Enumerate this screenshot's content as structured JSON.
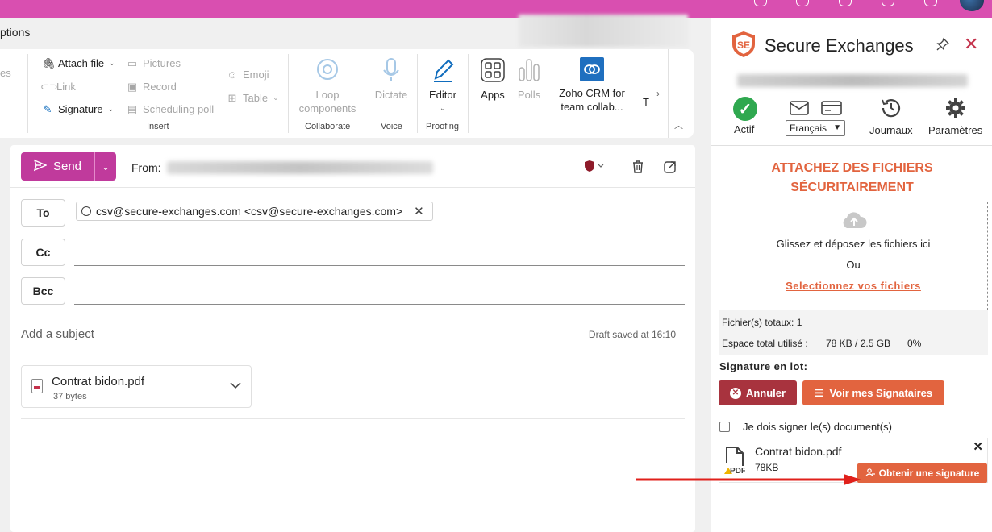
{
  "topbar": {
    "color": "#d94fb0"
  },
  "left_strip": {
    "options_label": "ptions"
  },
  "ribbon": {
    "attach_file": "Attach file",
    "link": "Link",
    "signature": "Signature",
    "pictures": "Pictures",
    "record": "Record",
    "scheduling_poll": "Scheduling poll",
    "emoji": "Emoji",
    "table": "Table",
    "insert_group": "Insert",
    "loop_components": "Loop components",
    "collaborate_group": "Collaborate",
    "dictate": "Dictate",
    "voice_group": "Voice",
    "editor": "Editor",
    "proofing_group": "Proofing",
    "apps": "Apps",
    "polls": "Polls",
    "zoho": "Zoho CRM for team collab...",
    "overflow": "T",
    "truncated_left": "es"
  },
  "compose": {
    "send_label": "Send",
    "from_label": "From:",
    "to_label": "To",
    "cc_label": "Cc",
    "bcc_label": "Bcc",
    "recipient": "csv@secure-exchanges.com <csv@secure-exchanges.com>",
    "subject_placeholder": "Add a subject",
    "draft_status": "Draft saved at 16:10",
    "attachment": {
      "name": "Contrat bidon.pdf",
      "size": "37 bytes"
    }
  },
  "panel": {
    "title": "Secure Exchanges",
    "nav": {
      "actif": "Actif",
      "language": "Français",
      "journaux": "Journaux",
      "parametres": "Paramètres"
    },
    "attach_title_line1": "ATTACHEZ DES FICHIERS",
    "attach_title_line2": "SÉCURITAIREMENT",
    "dropzone": {
      "drag_text": "Glissez et déposez les fichiers ici",
      "or_text": "Ou",
      "select_link": "Selectionnez vos fichiers"
    },
    "stats": {
      "total_files": "Fichier(s) totaux: 1",
      "space_label": "Espace total utilisé :",
      "space_value": "78 KB / 2.5 GB",
      "space_percent": "0%"
    },
    "signature_label": "Signature en lot:",
    "cancel_button": "Annuler",
    "signers_button": "Voir mes Signataires",
    "must_sign_label": "Je dois signer le(s) document(s)",
    "file": {
      "name": "Contrat bidon.pdf",
      "size": "78KB",
      "icon_text": "PDF"
    },
    "get_signature_button": "Obtenir une signature",
    "colors": {
      "accent": "#e2643f",
      "danger": "#a8333e",
      "success": "#2fa84f"
    }
  }
}
